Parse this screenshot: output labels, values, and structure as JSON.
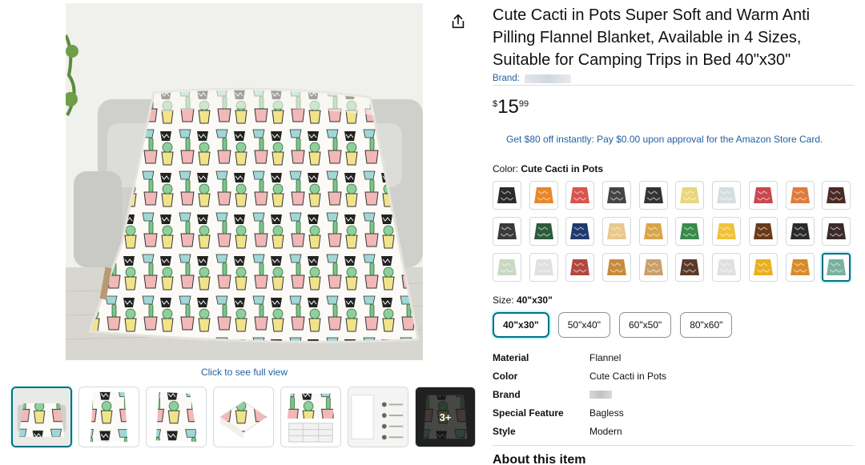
{
  "product": {
    "title": "Cute Cacti in Pots Super Soft and Warm Anti Pilling Flannel Blanket, Available in 4 Sizes, Suitable for Camping Trips in Bed 40\"x30\"",
    "brand_prefix": "Brand:",
    "price_symbol": "$",
    "price_whole": "15",
    "price_fraction": "99",
    "promo_text": "Get $80 off instantly: Pay $0.00 upon approval for the Amazon Store Card."
  },
  "gallery": {
    "full_view_text": "Click to see full view",
    "more_label": "3+"
  },
  "color": {
    "label": "Color:",
    "selected": "Cute Cacti in Pots",
    "swatch_colors": [
      "#2a2a2a",
      "#e8862a",
      "#d9534f",
      "#444444",
      "#333333",
      "#e8d77a",
      "#d6dde0",
      "#c9474f",
      "#e07a3c",
      "#4a2a22",
      "#3a3a3a",
      "#2d5a3a",
      "#1f3a6b",
      "#e9c88a",
      "#d9a54a",
      "#3a8a4a",
      "#f0c23a",
      "#6a3a1a",
      "#2a2a2a",
      "#3a2a2a",
      "#c7d9c2",
      "#e0e0e0",
      "#b3473f",
      "#c98a3a",
      "#c9a06a",
      "#5a3a2a",
      "#e0e0e0",
      "#e8b020",
      "#d98a2a",
      "#7ab0a0"
    ]
  },
  "size": {
    "label": "Size:",
    "selected": "40\"x30\"",
    "options": [
      "40\"x30\"",
      "50\"x40\"",
      "60\"x50\"",
      "80\"x60\""
    ]
  },
  "specs": [
    {
      "key": "Material",
      "value": "Flannel"
    },
    {
      "key": "Color",
      "value": "Cute Cacti in Pots"
    },
    {
      "key": "Brand",
      "value": ""
    },
    {
      "key": "Special Feature",
      "value": "Bagless"
    },
    {
      "key": "Style",
      "value": "Modern"
    }
  ],
  "about_heading": "About this item"
}
